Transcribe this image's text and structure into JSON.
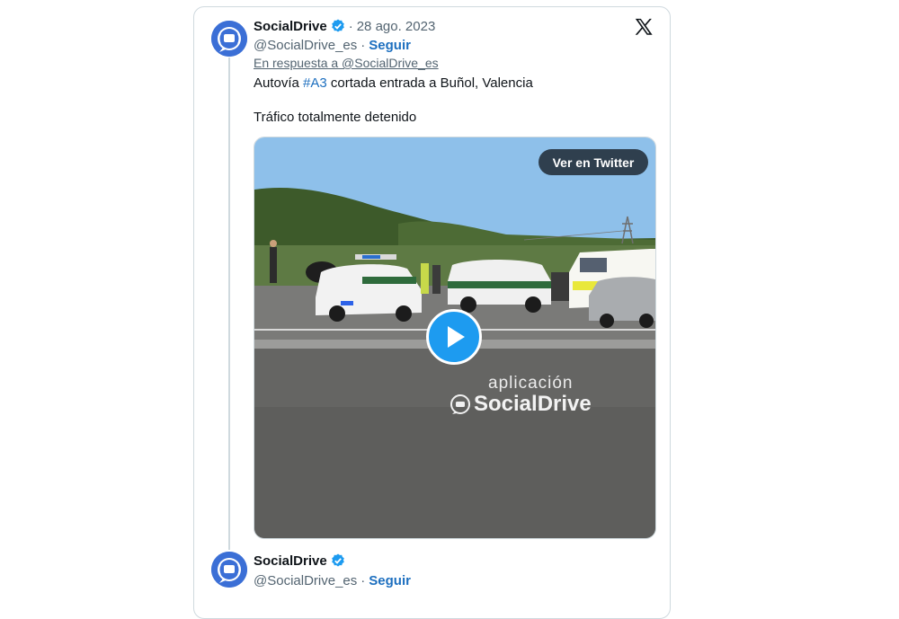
{
  "tweet1": {
    "name": "SocialDrive",
    "date_sep": "·",
    "date": "28 ago. 2023",
    "handle": "@SocialDrive_es",
    "handle_sep": "·",
    "follow": "Seguir",
    "reply_to": "En respuesta a @SocialDrive_es",
    "text_line1_pre": "Autovía ",
    "text_line1_tag": "#A3",
    "text_line1_post": " cortada entrada a Buñol, Valencia",
    "text_line2": "Tráfico totalmente detenido",
    "media": {
      "view_button": "Ver en Twitter",
      "watermark_small": "aplicación",
      "watermark_brand": "SocialDrive"
    }
  },
  "tweet2": {
    "name": "SocialDrive",
    "handle": "@SocialDrive_es",
    "handle_sep": "·",
    "follow": "Seguir"
  },
  "colors": {
    "link": "#1d6fbf",
    "verified": "#1d9bf0",
    "play": "#1d9bf0",
    "avatar": "#3b6fd6"
  },
  "icons": [
    "verified-badge-icon",
    "x-logo-icon",
    "play-icon",
    "socialdrive-logo-icon"
  ]
}
